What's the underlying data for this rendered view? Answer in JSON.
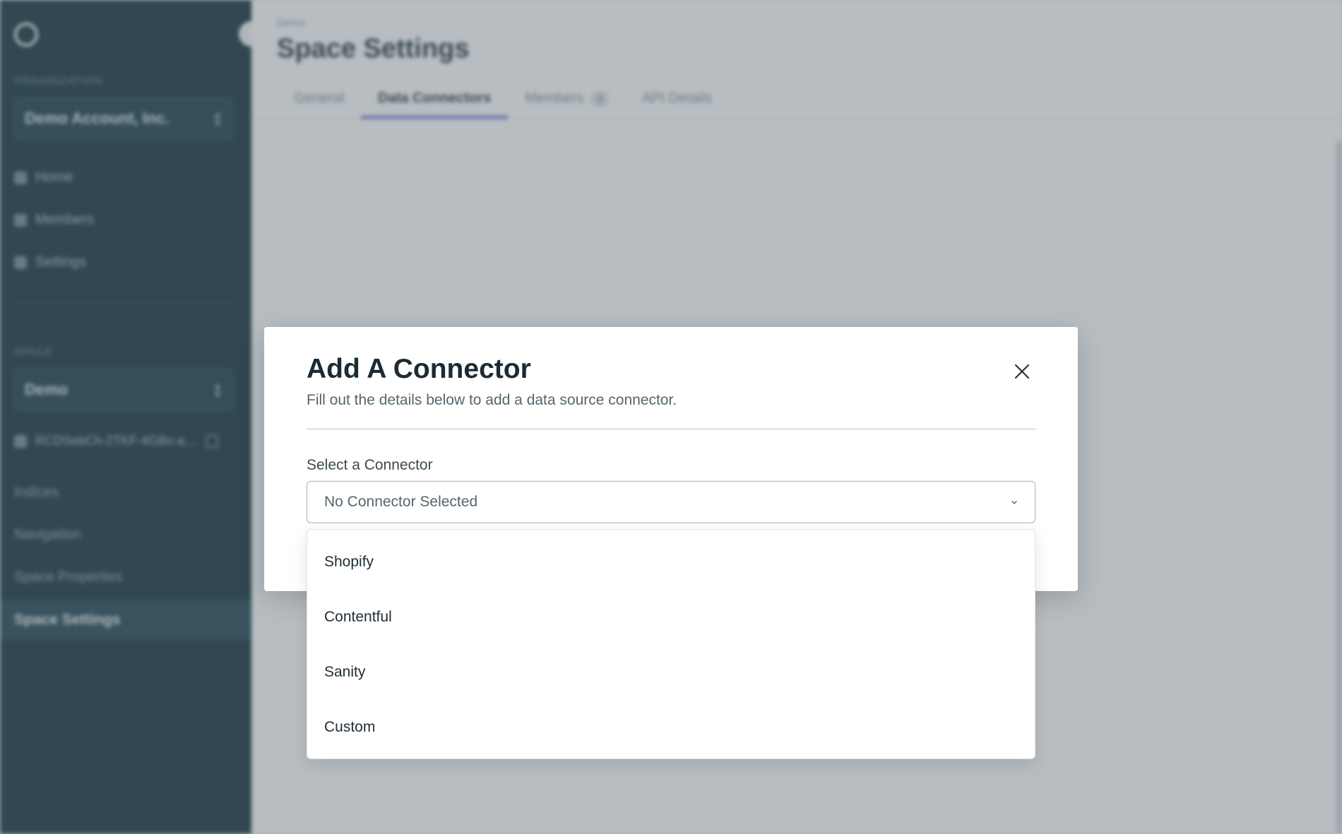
{
  "sidebar": {
    "section_org": "ORGANIZATION",
    "org_select_value": "Demo Account, Inc.",
    "items": [
      {
        "label": "Home",
        "icon": "home-icon"
      },
      {
        "label": "Members",
        "icon": "members-icon"
      },
      {
        "label": "Settings",
        "icon": "settings-icon"
      }
    ],
    "section_space": "SPACE",
    "space_select_value": "Demo",
    "space_id": "RCDSebCh-2TKF-4GBv-a…",
    "links": [
      "Indices",
      "Navigation",
      "Space Properties"
    ],
    "active": "Space Settings"
  },
  "header": {
    "breadcrumb": "Demo",
    "title": "Space Settings",
    "tabs": [
      {
        "label": "General"
      },
      {
        "label": "Data Connectors",
        "active": true
      },
      {
        "label": "Members",
        "count": "3"
      },
      {
        "label": "API Details"
      }
    ]
  },
  "modal": {
    "title": "Add A Connector",
    "subtitle": "Fill out the details below to add a data source connector.",
    "field_label": "Select a Connector",
    "select_value": "No Connector Selected",
    "options": [
      "Shopify",
      "Contentful",
      "Sanity",
      "Custom"
    ]
  },
  "colors": {
    "sidebar_bg": "#0b2b35",
    "accent": "#6a5bd6"
  }
}
